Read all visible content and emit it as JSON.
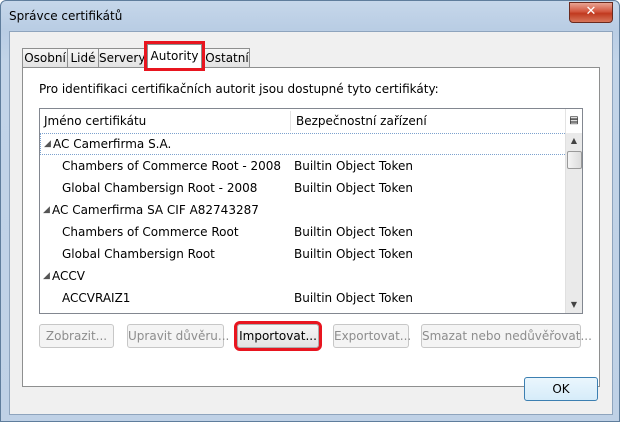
{
  "window": {
    "title": "Správce certifikátů",
    "close_glyph": "✕"
  },
  "tabs": [
    {
      "label": "Osobní"
    },
    {
      "label": "Lidé"
    },
    {
      "label": "Servery"
    },
    {
      "label": "Autority",
      "active": true
    },
    {
      "label": "Ostatní"
    }
  ],
  "panel": {
    "description": "Pro identifikaci certifikačních autorit jsou dostupné tyto certifikáty:",
    "columns": {
      "name": "Jméno certifikátu",
      "device": "Bezpečnostní zařízení"
    },
    "rows": [
      {
        "name": "AC Camerfirma S.A.",
        "device": "",
        "group": true,
        "expanded_glyph": "◢"
      },
      {
        "name": "Chambers of Commerce Root - 2008",
        "device": "Builtin Object Token"
      },
      {
        "name": "Global Chambersign Root - 2008",
        "device": "Builtin Object Token"
      },
      {
        "name": "AC Camerfirma SA CIF A82743287",
        "device": "",
        "group": true,
        "expanded_glyph": "◢"
      },
      {
        "name": "Chambers of Commerce Root",
        "device": "Builtin Object Token"
      },
      {
        "name": "Global Chambersign Root",
        "device": "Builtin Object Token"
      },
      {
        "name": "ACCV",
        "device": "",
        "group": true,
        "expanded_glyph": "◢"
      },
      {
        "name": "ACCVRAIZ1",
        "device": "Builtin Object Token"
      }
    ]
  },
  "buttons": {
    "view": "Zobrazit...",
    "trust": "Upravit důvěru...",
    "import": "Importovat...",
    "export": "Exportovat...",
    "delete": "Smazat nebo nedůvěřovat...",
    "ok": "OK"
  },
  "colors": {
    "highlight": "#e8151f",
    "title_bg": "#b9cde4"
  }
}
